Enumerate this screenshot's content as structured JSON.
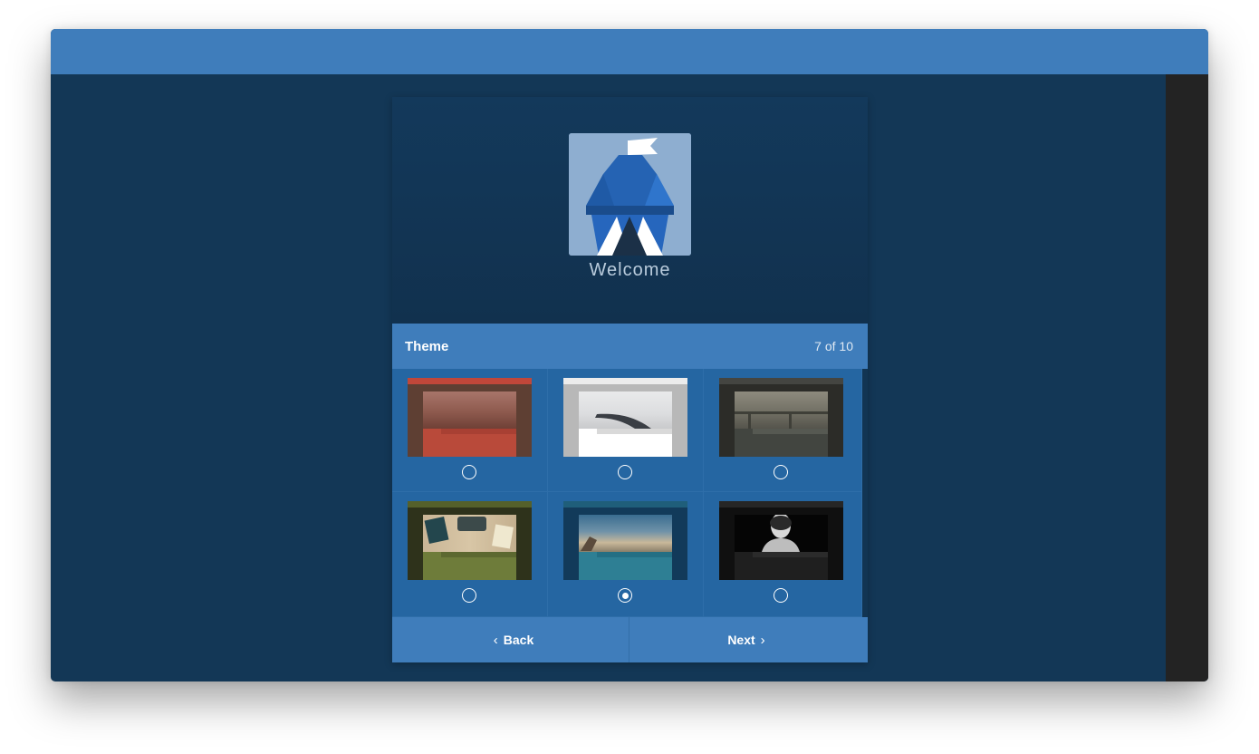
{
  "app": {
    "welcome_text": "Welcome",
    "logo_icon": "castle-flag-logo-icon"
  },
  "section": {
    "title": "Theme",
    "step": "7 of 10"
  },
  "themes": [
    {
      "name": "red-forest",
      "accent": "#c0473a",
      "bg": "#5e3f33",
      "selected": false
    },
    {
      "name": "white-snow-road",
      "accent": "#e8e8e8",
      "bg": "#b8b8b8",
      "selected": false
    },
    {
      "name": "grey-bridge",
      "accent": "#444541",
      "bg": "#2c2c28",
      "selected": false
    },
    {
      "name": "olive-typewriter",
      "accent": "#6e7c3a",
      "bg": "#2e321b",
      "selected": false
    },
    {
      "name": "teal-beach",
      "accent": "#2e7f94",
      "bg": "#123a5a",
      "selected": true
    },
    {
      "name": "black-portrait",
      "accent": "#1f1f1f",
      "bg": "#101010",
      "selected": false
    }
  ],
  "footer": {
    "back_label": "Back",
    "next_label": "Next",
    "back_icon": "chevron-left-icon",
    "next_icon": "chevron-right-icon"
  },
  "colors": {
    "primary": "#3f7dbb",
    "background": "#133756",
    "grid": "#2566a2"
  }
}
